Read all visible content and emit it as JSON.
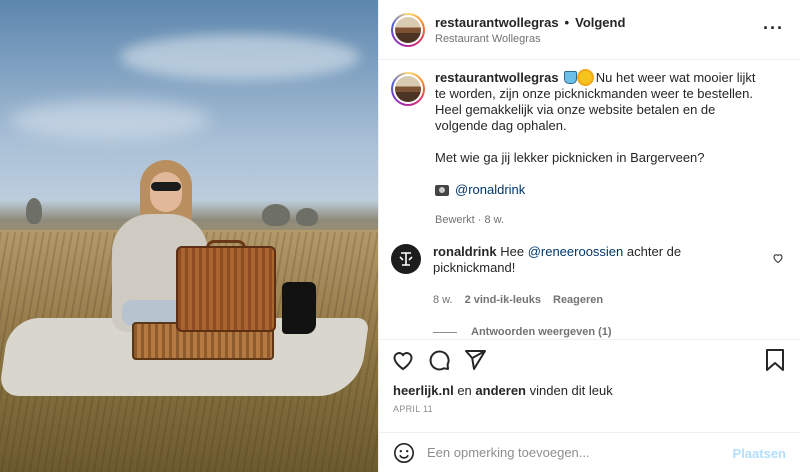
{
  "header": {
    "username": "restaurantwollegras",
    "separator": "•",
    "follow_status": "Volgend",
    "subtitle": "Restaurant Wollegras"
  },
  "caption": {
    "username": "restaurantwollegras",
    "text": "Nu het weer wat mooier lijkt te worden, zijn onze picknickmanden weer te bestellen. Heel gemakkelijk via onze website betalen en de volgende dag ophalen.",
    "question": "Met wie ga jij lekker picknicken in Bargerveen?",
    "credit": "@ronaldrink",
    "meta": "Bewerkt · 8 w."
  },
  "comment": {
    "username": "ronaldrink",
    "prefix": "Hee",
    "mention": "@reneeroossien",
    "suffix": "achter de picknickmand!",
    "time": "8 w.",
    "likes": "2 vind-ik-leuks",
    "reply": "Reageren",
    "view_replies": "Antwoorden weergeven (1)"
  },
  "likes": {
    "user": "heerlijk.nl",
    "middle": "en",
    "others": "anderen",
    "suffix": "vinden dit leuk"
  },
  "date": "APRIL 11",
  "add_comment": {
    "placeholder": "Een opmerking toevoegen...",
    "post_label": "Plaatsen"
  },
  "icons": {
    "more": "more-options-icon",
    "like": "heart-icon",
    "comment": "comment-icon",
    "share": "share-icon",
    "save": "bookmark-icon",
    "emoji": "emoji-icon"
  },
  "colors": {
    "mention": "#00376b",
    "muted": "#737373",
    "post_disabled": "#b2dffc"
  }
}
